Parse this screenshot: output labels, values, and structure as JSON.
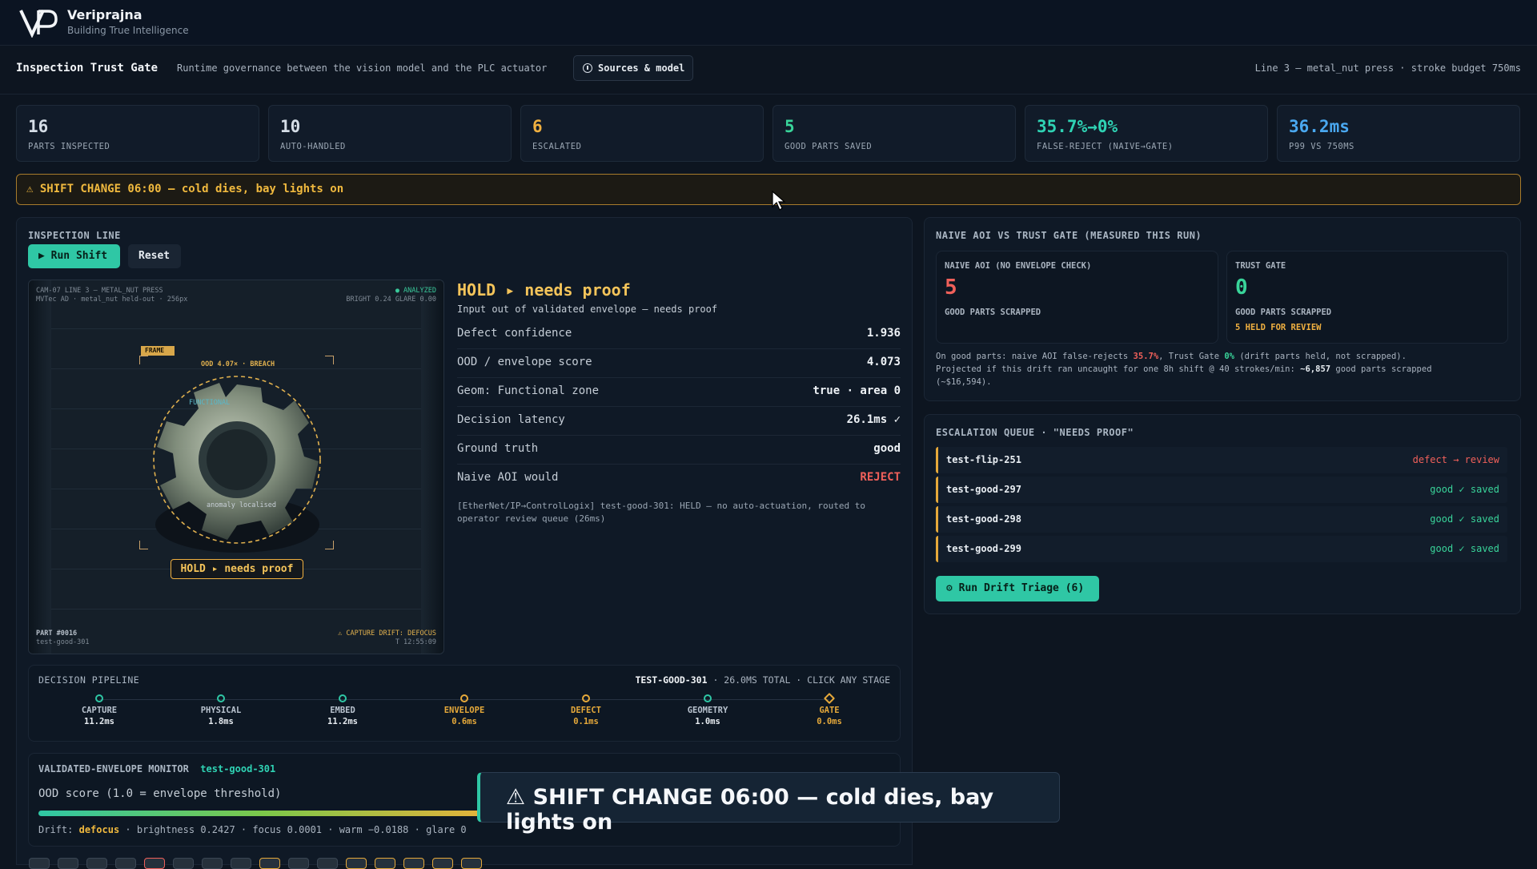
{
  "brand": {
    "name": "Veriprajna",
    "tagline": "Building True Intelligence"
  },
  "header": {
    "title": "Inspection Trust Gate",
    "subtitle": "Runtime governance between the vision model and the PLC actuator",
    "sources_label": "Sources & model",
    "line_info": "Line 3 — metal_nut press · stroke budget 750ms"
  },
  "kpis": [
    {
      "value": "16",
      "label": "PARTS INSPECTED",
      "color": "#f2f5f8"
    },
    {
      "value": "10",
      "label": "AUTO-HANDLED",
      "color": "#f2f5f8"
    },
    {
      "value": "6",
      "label": "ESCALATED",
      "color": "#f0b040"
    },
    {
      "value": "5",
      "label": "GOOD PARTS SAVED",
      "color": "#39d49a"
    },
    {
      "value": "35.7%→0%",
      "label": "FALSE-REJECT (NAIVE→GATE)",
      "color": "#2fd3b4"
    },
    {
      "value": "36.2ms",
      "label": "P99 VS 750MS",
      "color": "#4aa8f0"
    }
  ],
  "banner": {
    "text": "⚠ SHIFT CHANGE 06:00 — cold dies, bay lights on"
  },
  "inspection": {
    "header": "INSPECTION LINE",
    "run_label": "▶ Run Shift",
    "reset_label": "Reset",
    "camera": {
      "line1": "CAM-07  LINE 3 — METAL_NUT PRESS",
      "line2": "MVTec AD · metal_nut held-out · 256px",
      "analyzed": "● ANALYZED",
      "bright": "BRIGHT 0.24  GLARE 0.00",
      "frame_label": "FRAME",
      "ood_label": "OOD 4.07× · BREACH",
      "functional_label": "FUNCTIONAL",
      "anomaly_label": "anomaly localised",
      "hold_tag": "HOLD ▸ needs proof",
      "part_no": "PART #0016",
      "part_id": "test-good-301",
      "drift": "⚠ CAPTURE DRIFT: DEFOCUS",
      "time": "T 12:55:09"
    },
    "decision": {
      "title": "HOLD ▸ needs proof",
      "subtitle": "Input out of validated envelope — needs proof",
      "rows": [
        {
          "k": "Defect confidence",
          "v": "1.936"
        },
        {
          "k": "OOD / envelope score",
          "v": "4.073"
        },
        {
          "k": "Geom: Functional zone",
          "v": "true · area 0"
        },
        {
          "k": "Decision latency",
          "v": "26.1ms ✓"
        },
        {
          "k": "Ground truth",
          "v": "good"
        },
        {
          "k": "Naive AOI would",
          "v": "REJECT"
        }
      ],
      "log": "[EtherNet/IP→ControlLogix] test-good-301: HELD — no auto-actuation, routed to operator review queue (26ms)"
    }
  },
  "pipeline": {
    "header": "DECISION PIPELINE",
    "part": "TEST-GOOD-301",
    "meta": " · 26.0MS TOTAL · CLICK ANY STAGE",
    "stages": [
      {
        "name": "CAPTURE",
        "time": "11.2ms",
        "state": "ok"
      },
      {
        "name": "PHYSICAL",
        "time": "1.8ms",
        "state": "ok"
      },
      {
        "name": "EMBED",
        "time": "11.2ms",
        "state": "ok"
      },
      {
        "name": "ENVELOPE",
        "time": "0.6ms",
        "state": "warn"
      },
      {
        "name": "DEFECT",
        "time": "0.1ms",
        "state": "warn"
      },
      {
        "name": "GEOMETRY",
        "time": "1.0ms",
        "state": "ok"
      },
      {
        "name": "GATE",
        "time": "0.0ms",
        "state": "gate"
      }
    ]
  },
  "monitor": {
    "header": "VALIDATED-ENVELOPE MONITOR",
    "part": "test-good-301",
    "ood_label": "OOD score (1.0 = envelope threshold)",
    "drift_label": "Drift:",
    "drift_type": "defocus",
    "drift_values": " · brightness 0.2427 · focus 0.0001 · warm −0.0188 · glare 0"
  },
  "comparison": {
    "header": "NAIVE AOI VS TRUST GATE (MEASURED THIS RUN)",
    "naive": {
      "title": "NAIVE AOI (NO ENVELOPE CHECK)",
      "value": "5",
      "label": "GOOD PARTS SCRAPPED"
    },
    "gate": {
      "title": "TRUST GATE",
      "value": "0",
      "label": "GOOD PARTS SCRAPPED",
      "note": "5 HELD FOR REVIEW"
    },
    "note_a": "On good parts: naive AOI false-rejects ",
    "note_pct_naive": "35.7%",
    "note_b": ", Trust Gate ",
    "note_pct_gate": "0%",
    "note_c": " (drift parts held, not scrapped).",
    "note_d": "Projected if this drift ran uncaught for one 8h shift @ 40 strokes/min: ",
    "note_e": "~6,857",
    "note_f": " good parts scrapped",
    "note_g": "(~$16,594)."
  },
  "queue": {
    "header": "ESCALATION QUEUE · \"NEEDS PROOF\"",
    "items": [
      {
        "id": "test-flip-251",
        "status": "defect → review",
        "color": "#f0605a"
      },
      {
        "id": "test-good-297",
        "status": "good ✓ saved",
        "color": "#39d49a"
      },
      {
        "id": "test-good-298",
        "status": "good ✓ saved",
        "color": "#39d49a"
      },
      {
        "id": "test-good-299",
        "status": "good ✓ saved",
        "color": "#39d49a"
      }
    ],
    "triage_label": "⚙ Run Drift Triage (6)"
  },
  "toast": {
    "text": "⚠ SHIFT CHANGE 06:00 — cold dies, bay lights on"
  },
  "icons": {
    "logo": "vp-logo",
    "info": "info-icon",
    "cursor": "mouse-cursor"
  },
  "colors": {
    "accent": "#2fc7a5",
    "warn": "#f0b040",
    "danger": "#f0605a",
    "good": "#39d49a",
    "blue": "#4aa8f0"
  }
}
